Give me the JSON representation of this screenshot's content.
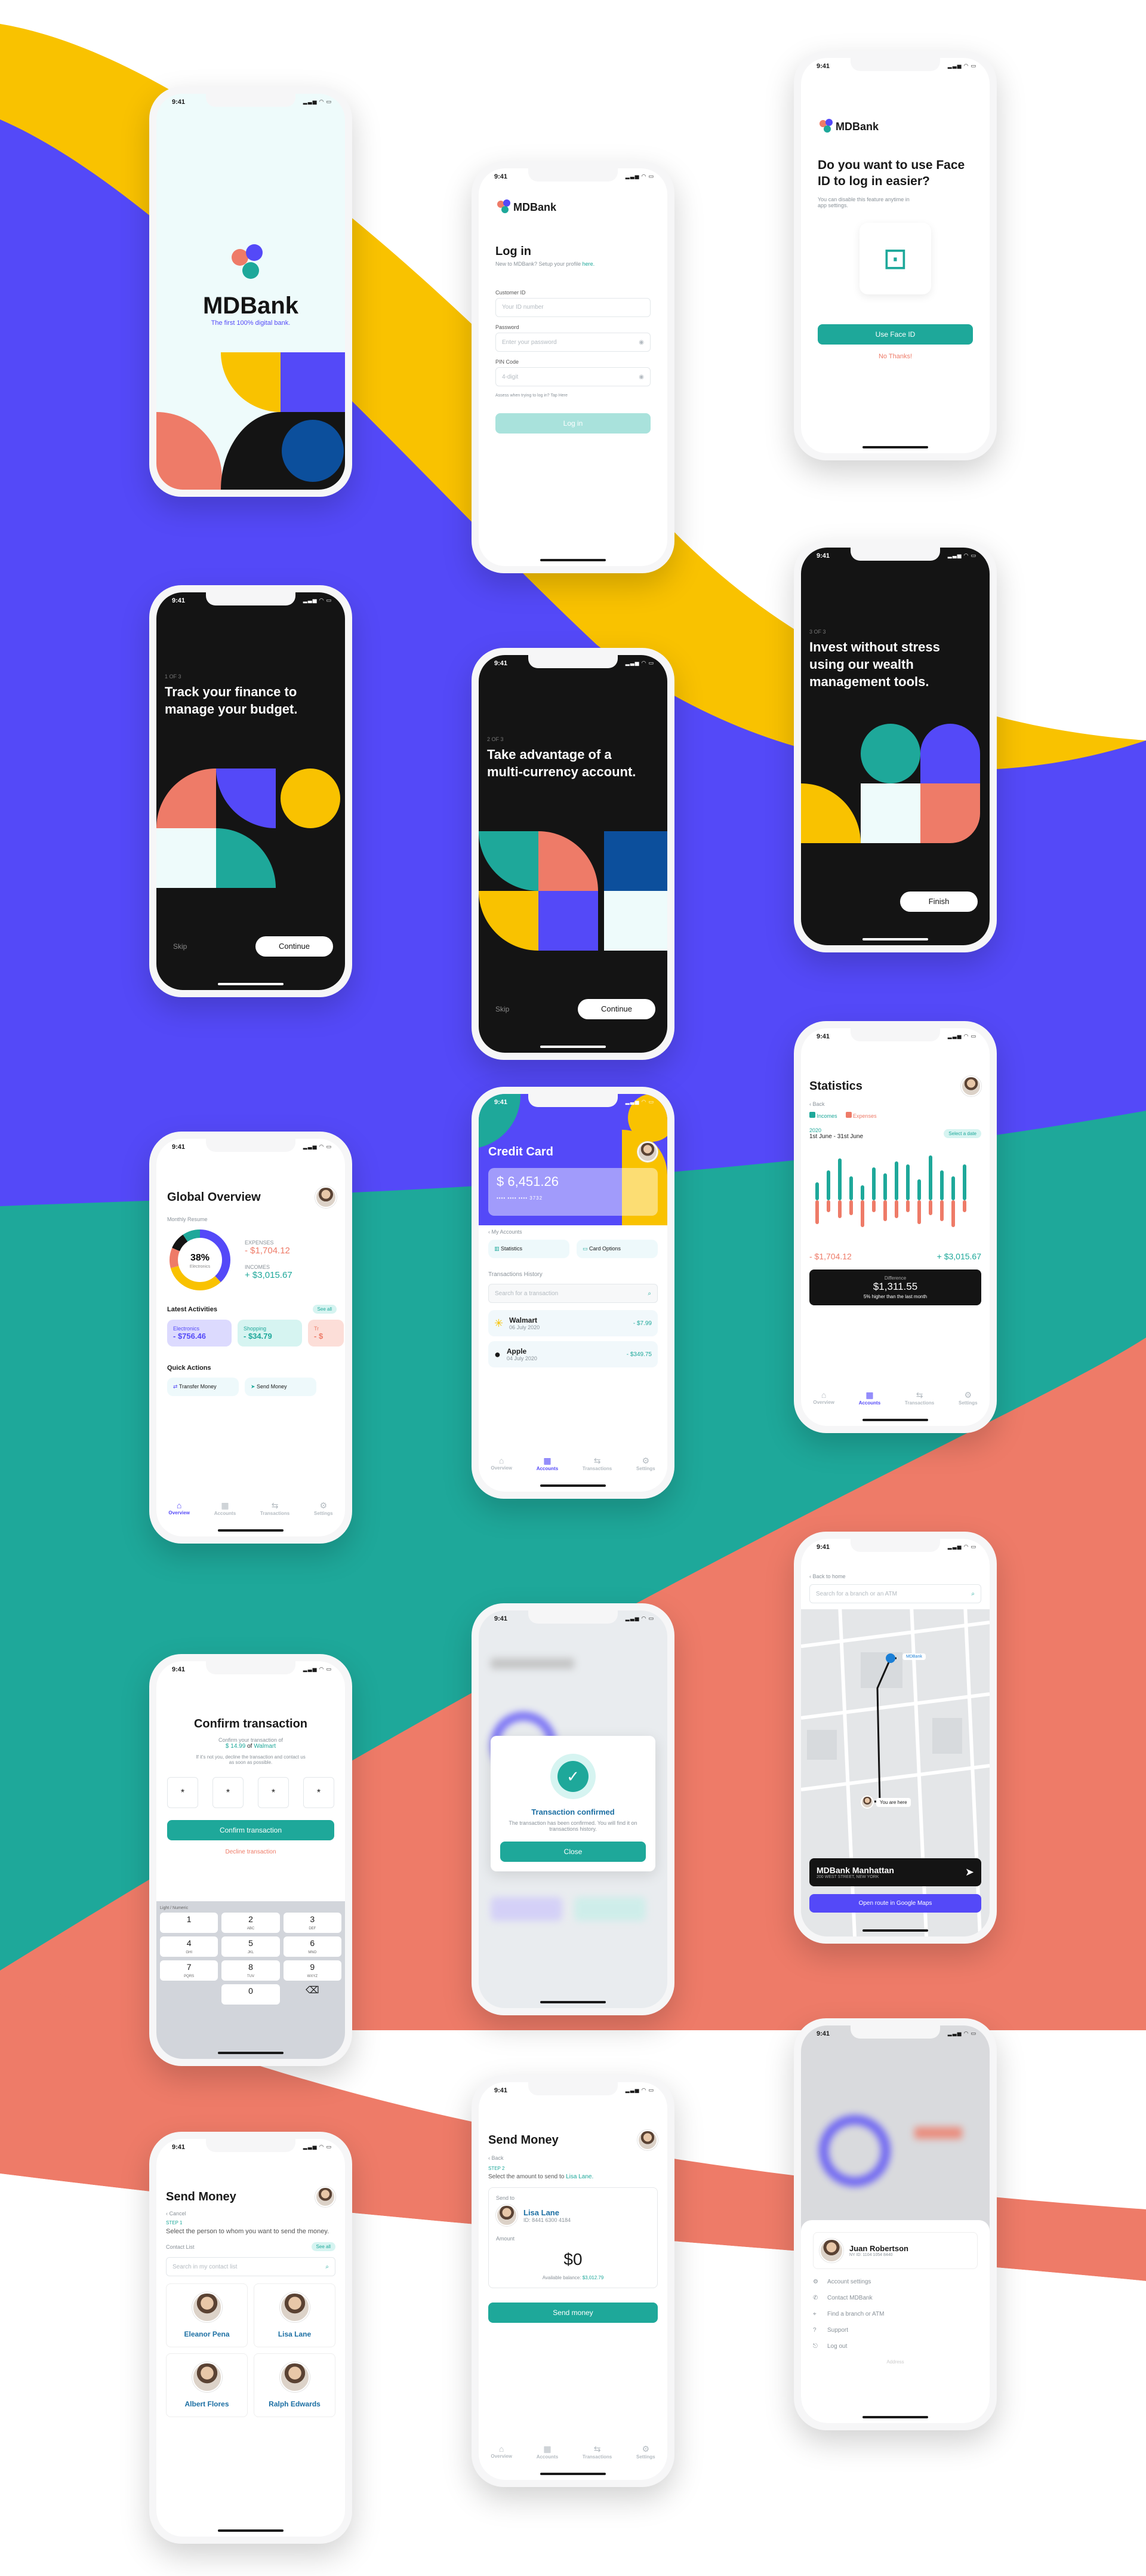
{
  "colors": {
    "yellow": "#f9c200",
    "blue": "#5449f8",
    "teal": "#1ea89a",
    "salmon": "#ee7b68",
    "dark": "#141414",
    "navy": "#0c4f9c"
  },
  "status_time": "9:41",
  "brand": {
    "name": "MDBank",
    "tagline": "The first 100% digital bank."
  },
  "login": {
    "title": "Log in",
    "subtitle": "New to MDBank? Setup your profile",
    "subtitle_link": "here.",
    "customer_id_label": "Customer ID",
    "customer_id_placeholder": "Your ID number",
    "password_label": "Password",
    "password_placeholder": "Enter your password",
    "pin_label": "PIN Code",
    "pin_placeholder": "4-digit",
    "terms": "Assess when trying to log in? Tap Here",
    "button": "Log in"
  },
  "faceid": {
    "title": "Do you want to use Face ID to log in easier?",
    "note": "You can disable this feature anytime in app settings.",
    "primary": "Use Face ID",
    "secondary": "No Thanks!"
  },
  "onboarding": [
    {
      "step": "1 OF 3",
      "title": "Track your finance to manage your budget.",
      "skip": "Skip",
      "cta": "Continue"
    },
    {
      "step": "2 OF 3",
      "title": "Take advantage of a multi-currency account.",
      "skip": "Skip",
      "cta": "Continue"
    },
    {
      "step": "3 OF 3",
      "title": "Invest without stress using our wealth management tools.",
      "cta": "Finish"
    }
  ],
  "overview": {
    "title": "Global Overview",
    "section": "Monthly Resume",
    "donut_pct": "38%",
    "donut_label": "Electronics",
    "expenses_label": "EXPENSES",
    "expenses": "- $1,704.12",
    "incomes_label": "INCOMES",
    "incomes": "+ $3,015.67",
    "activities_title": "Latest Activities",
    "see_all": "See all",
    "activities": [
      {
        "name": "Electronics",
        "amount": "- $756.46"
      },
      {
        "name": "Shopping",
        "amount": "- $34.79"
      },
      {
        "name": "Tr",
        "amount": "- $"
      }
    ],
    "quick_title": "Quick Actions",
    "quick": [
      "Transfer Money",
      "Send Money"
    ],
    "tabs": [
      "Overview",
      "Accounts",
      "Transactions",
      "Settings"
    ]
  },
  "credit": {
    "title": "Credit Card",
    "balance": "$ 6,451.26",
    "card_number": "•••• •••• •••• 3732",
    "back": "My Accounts",
    "options": [
      "Statistics",
      "Card Options"
    ],
    "history_title": "Transactions History",
    "search_placeholder": "Search for a transaction",
    "transactions": [
      {
        "name": "Walmart",
        "date": "06 July 2020",
        "amount": "- $7.99"
      },
      {
        "name": "Apple",
        "date": "04 July 2020",
        "amount": "- $349.75"
      }
    ],
    "tabs": [
      "Overview",
      "Accounts",
      "Transactions",
      "Settings"
    ]
  },
  "stats": {
    "title": "Statistics",
    "back": "Back",
    "legend": [
      "Incomes",
      "Expenses"
    ],
    "year": "2020",
    "range": "1st June - 31st June",
    "select": "Select a date",
    "expense": "- $1,704.12",
    "income": "+ $3,015.67",
    "diff_label": "Difference",
    "diff": "$1,311.55",
    "diff_note": "5% higher than the last month",
    "tabs": [
      "Overview",
      "Accounts",
      "Transactions",
      "Settings"
    ]
  },
  "confirm": {
    "title": "Confirm transaction",
    "line1": "Confirm your transaction of",
    "amount": "$ 14.99",
    "of": "of",
    "merchant": "Walmart",
    "note": "If it's not you, decline the transaction and contact us as soon as possible.",
    "pin": [
      "*",
      "*",
      "*",
      "*"
    ],
    "primary": "Confirm transaction",
    "secondary": "Decline transaction",
    "keyboard_label": "Light / Numeric",
    "keys": [
      {
        "n": "1",
        "s": ""
      },
      {
        "n": "2",
        "s": "ABC"
      },
      {
        "n": "3",
        "s": "DEF"
      },
      {
        "n": "4",
        "s": "GHI"
      },
      {
        "n": "5",
        "s": "JKL"
      },
      {
        "n": "6",
        "s": "MNO"
      },
      {
        "n": "7",
        "s": "PQRS"
      },
      {
        "n": "8",
        "s": "TUV"
      },
      {
        "n": "9",
        "s": "WXYZ"
      },
      {
        "n": "0",
        "s": ""
      }
    ]
  },
  "confirmed": {
    "title": "Transaction confirmed",
    "text": "The transaction has been confirmed. You will find it on transactions history.",
    "button": "Close"
  },
  "map": {
    "back": "Back to home",
    "search_placeholder": "Search for a branch or an ATM",
    "pin_label": "MDBank",
    "you_label": "You are here",
    "branch": "MDBank Manhattan",
    "address": "200 WEST STREET, NEW YORK",
    "button": "Open route in Google Maps"
  },
  "sendstep1": {
    "title": "Send Money",
    "cancel": "Cancel",
    "step": "STEP 1",
    "instruction": "Select the person to whom you want to send the money.",
    "list_title": "Contact List",
    "see_all": "See all",
    "search_placeholder": "Search in my contact list",
    "contacts": [
      "Eleanor Pena",
      "Lisa Lane",
      "Albert Flores",
      "Ralph Edwards"
    ]
  },
  "sendstep2": {
    "title": "Send Money",
    "back": "Back",
    "step": "STEP 2",
    "instruction": "Select the amount to send to",
    "instruction_name": "Lisa Lane.",
    "send_to": "Send to",
    "name": "Lisa Lane",
    "id": "ID: 8441 6300 4184",
    "amount_label": "Amount",
    "amount": "$0",
    "available": "Available balance:",
    "available_amount": "$3,012.79",
    "button": "Send money",
    "tabs": [
      "Overview",
      "Accounts",
      "Transactions",
      "Settings"
    ]
  },
  "profile": {
    "name": "Juan Robertson",
    "id": "NY ID: 1104 1054 8440",
    "menu": [
      "Account settings",
      "Contact MDBank",
      "Find a branch or ATM",
      "Support",
      "Log out"
    ],
    "footer": "Address"
  }
}
